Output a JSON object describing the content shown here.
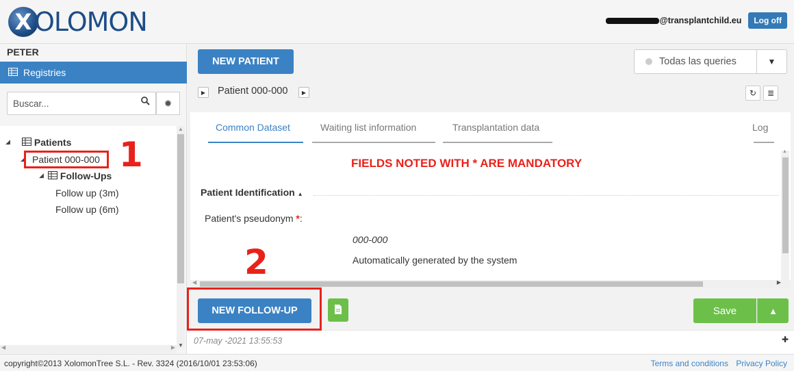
{
  "header": {
    "logo_initial": "X",
    "logo_text": "OLOMON",
    "user_email": "@transplantchild.eu",
    "logoff_label": "Log off"
  },
  "sidebar": {
    "user_name": "PETER",
    "registries_label": "Registries",
    "search": {
      "placeholder": "Buscar..."
    },
    "tree": {
      "root_label": "Patients",
      "patient_label": "Patient 000-000",
      "followups_label": "Follow-Ups",
      "items": [
        "Follow up (3m)",
        "Follow up (6m)"
      ]
    }
  },
  "toolbar": {
    "new_patient_label": "NEW PATIENT",
    "queries_label": "Todas las queries",
    "breadcrumb_label": "Patient 000-000"
  },
  "tabs": [
    {
      "label": "Common Dataset",
      "active": true
    },
    {
      "label": "Waiting list information",
      "active": false
    },
    {
      "label": "Transplantation data",
      "active": false
    },
    {
      "label": "Log",
      "active": false
    }
  ],
  "form": {
    "mandatory_note": "FIELDS NOTED WITH * ARE MANDATORY",
    "section_title": "Patient Identification",
    "pseudonym_label": "Patient's pseudonym",
    "pseudonym_star": "*",
    "pseudonym_colon": ":",
    "pseudonym_value": "000-000",
    "pseudonym_help": "Automatically generated by the system"
  },
  "actions": {
    "new_followup_label": "NEW FOLLOW-UP",
    "save_label": "Save"
  },
  "status": {
    "timestamp": "07-may -2021 13:55:53"
  },
  "footer": {
    "copyright": "copyright©2013 XolomonTree S.L. - Rev. 3324 (2016/10/01 23:53:06)",
    "terms_label": "Terms and conditions",
    "privacy_label": "Privacy Policy"
  },
  "annotations": [
    "1",
    "2"
  ],
  "colors": {
    "primary": "#3b82c4",
    "success": "#6cc04a",
    "danger": "#e8221b"
  }
}
